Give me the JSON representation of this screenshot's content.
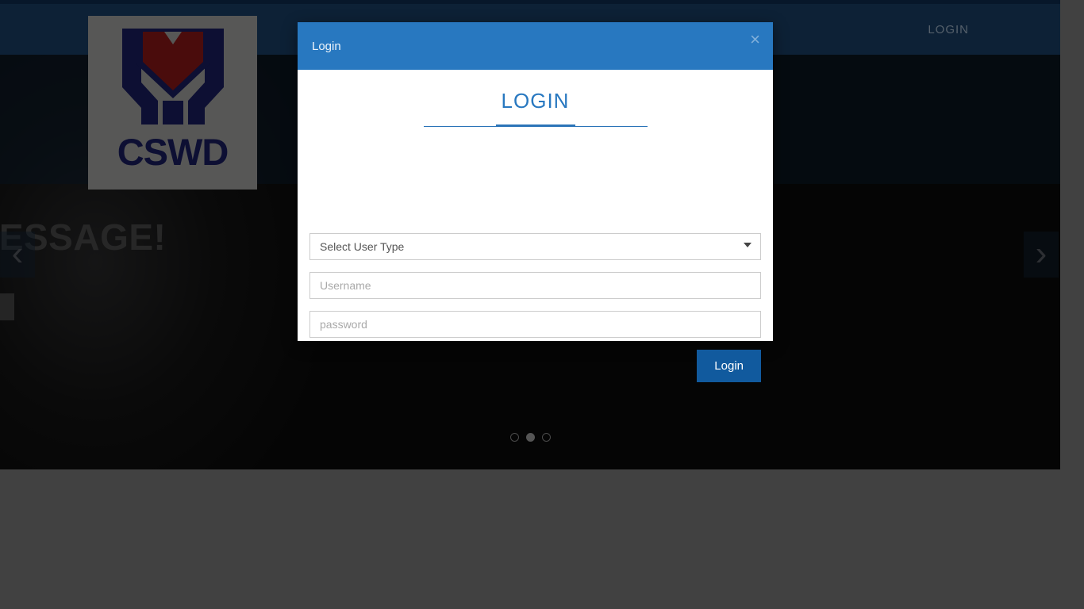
{
  "site": {
    "logo_text": "CSWD",
    "logo_icon": "hands-holding-heart-icon"
  },
  "navbar": {
    "login_label": "LOGIN"
  },
  "carousel": {
    "caption": "MESSAGE!",
    "prev_icon": "chevron-left-icon",
    "next_icon": "chevron-right-icon",
    "slides": [
      {
        "active": false
      },
      {
        "active": true
      },
      {
        "active": false
      }
    ]
  },
  "modal": {
    "title": "Login",
    "close_icon": "close-icon",
    "close_label": "×",
    "form": {
      "heading": "LOGIN",
      "user_type": {
        "selected": "Select User Type",
        "caret_icon": "chevron-down-icon",
        "options": [
          "Select User Type"
        ]
      },
      "username": {
        "value": "",
        "placeholder": "Username"
      },
      "password": {
        "value": "",
        "placeholder": "password"
      },
      "submit_label": "Login"
    }
  },
  "colors": {
    "nav_bg": "#0d2136",
    "modal_header": "#2878c0",
    "accent": "#2b74b8",
    "button": "#115a9e",
    "page_outside": "#414141",
    "logo_navy": "#0d0f33",
    "logo_red": "#4a0c0c"
  }
}
